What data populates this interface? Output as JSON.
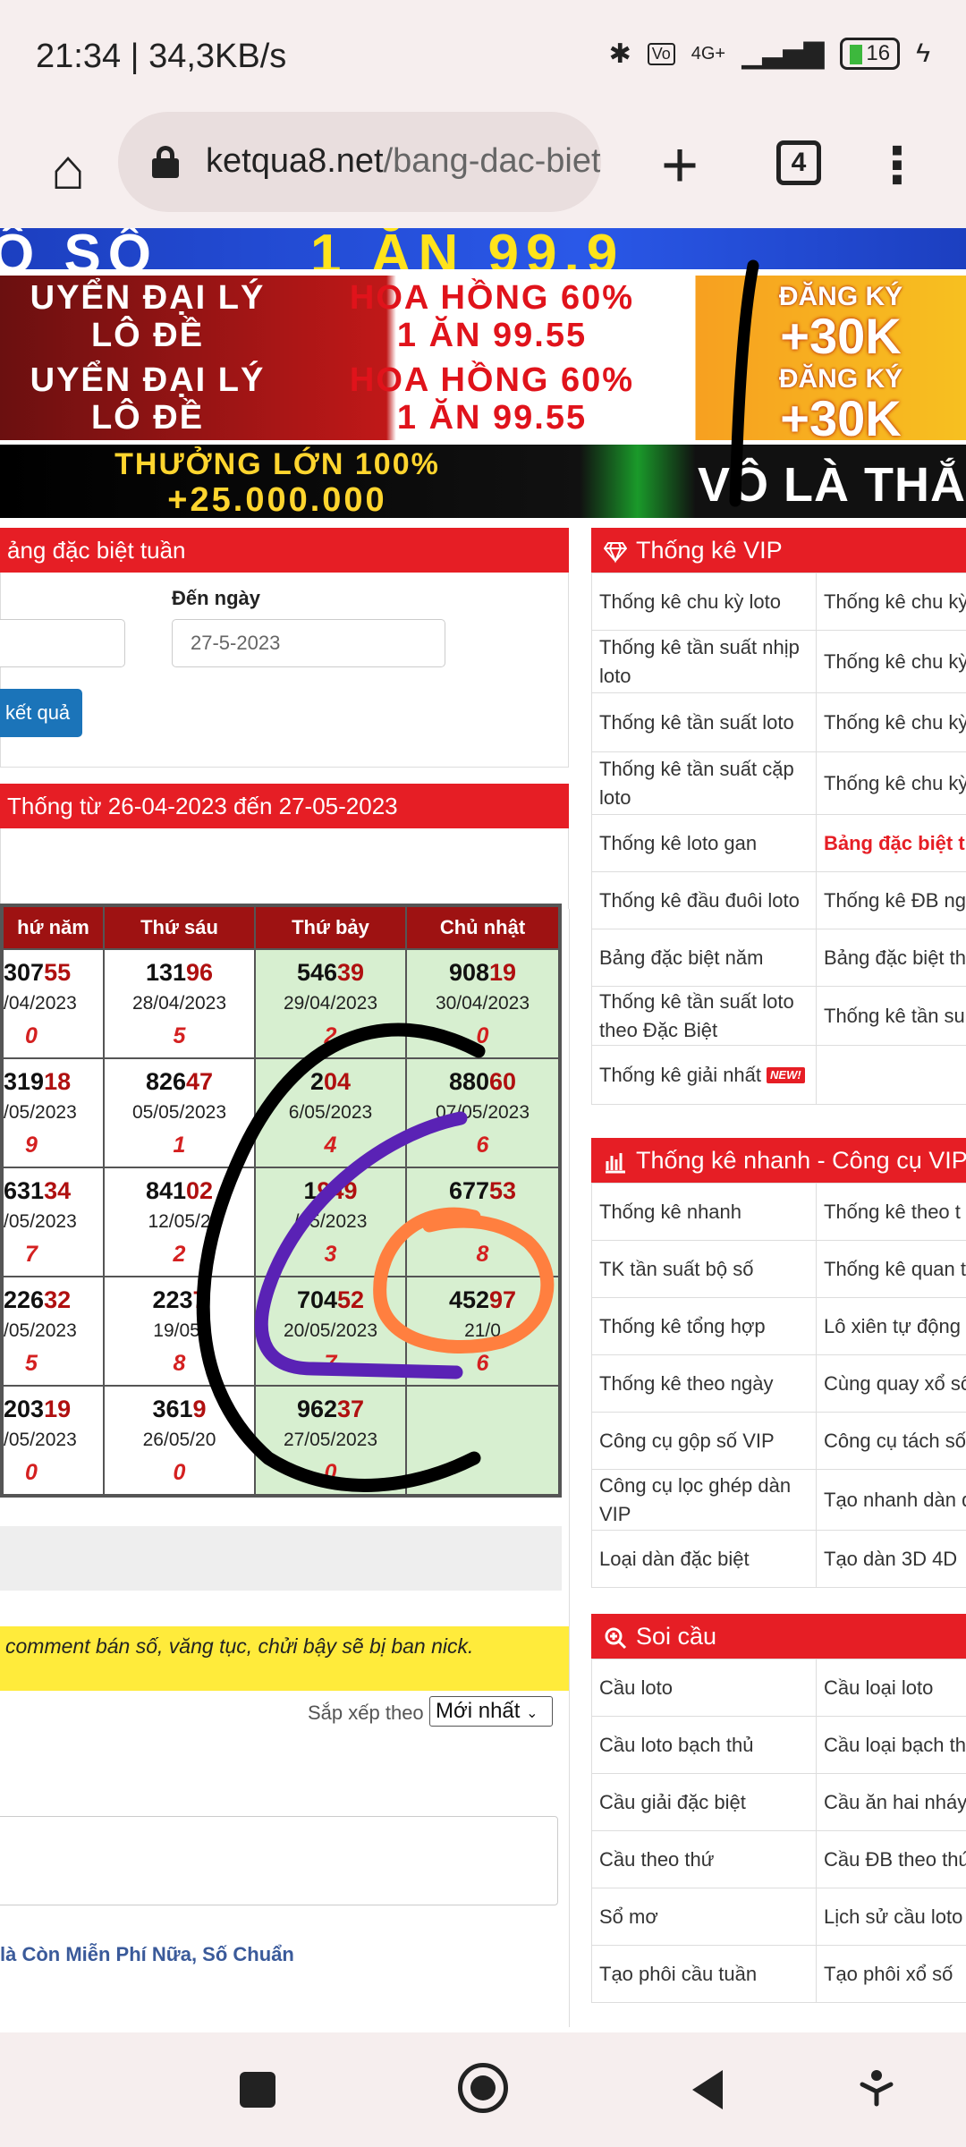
{
  "status": {
    "time": "21:34 | 34,3KB/s",
    "network": "4G+",
    "battery": "16"
  },
  "browser": {
    "url_host": "ketqua8.net",
    "url_path": "/bang-dac-biet",
    "tab_count": "4"
  },
  "banners": {
    "b1_left": "Ô SỐ",
    "b1_right": "1 ĂN 99,9",
    "agent_left": [
      "UYỂN ĐẠI LÝ",
      "LÔ ĐỀ"
    ],
    "agent_mid": [
      "HOA HỒNG 60%",
      "1 ĂN 99.55"
    ],
    "agent_right": [
      "ĐĂNG KÝ",
      "+30K"
    ],
    "b4_left": [
      "THƯỞNG LỚN 100%",
      "+25.000.000"
    ],
    "b4_right": "VÔ LÀ THẮ"
  },
  "main": {
    "header1": "ảng đặc biệt tuần",
    "to_label": "Đến ngày",
    "to_value": "27-5-2023",
    "view_button": "kết quả",
    "header2": "Thống từ 26-04-2023 đến 27-05-2023",
    "table": {
      "headers": [
        "hứ năm",
        "Thứ sáu",
        "Thứ bảy",
        "Chủ nhật"
      ],
      "rows": [
        [
          {
            "head": "307",
            "tail": "55",
            "date": "/04/2023",
            "count": "0"
          },
          {
            "head": "131",
            "tail": "96",
            "date": "28/04/2023",
            "count": "5"
          },
          {
            "head": "546",
            "tail": "39",
            "date": "29/04/2023",
            "count": "2"
          },
          {
            "head": "908",
            "tail": "19",
            "date": "30/04/2023",
            "count": "0"
          }
        ],
        [
          {
            "head": "319",
            "tail": "18",
            "date": "/05/2023",
            "count": "9"
          },
          {
            "head": "826",
            "tail": "47",
            "date": "05/05/2023",
            "count": "1"
          },
          {
            "head": "2",
            "tail": "04",
            "date": "6/05/2023",
            "count": "4"
          },
          {
            "head": "880",
            "tail": "60",
            "date": "07/05/2023",
            "count": "6"
          }
        ],
        [
          {
            "head": "631",
            "tail": "34",
            "date": "/05/2023",
            "count": "7"
          },
          {
            "head": "841",
            "tail": "02",
            "date": "12/05/2",
            "count": "2"
          },
          {
            "head": "1",
            "tail": "949",
            "date": "/05/2023",
            "count": "3"
          },
          {
            "head": "677",
            "tail": "53",
            "date": "",
            "count": "8"
          }
        ],
        [
          {
            "head": "226",
            "tail": "32",
            "date": "/05/2023",
            "count": "5"
          },
          {
            "head": "223",
            "tail": "7",
            "date": "19/05/",
            "count": "8"
          },
          {
            "head": "704",
            "tail": "52",
            "date": "20/05/2023",
            "count": "7"
          },
          {
            "head": "452",
            "tail": "97",
            "date": "21/0",
            "count": "6"
          }
        ],
        [
          {
            "head": "203",
            "tail": "19",
            "date": "/05/2023",
            "count": "0"
          },
          {
            "head": "361",
            "tail": "9",
            "date": "26/05/20",
            "count": "0"
          },
          {
            "head": "962",
            "tail": "37",
            "date": "27/05/2023",
            "count": "0"
          },
          {
            "head": "",
            "tail": "",
            "date": "",
            "count": ""
          }
        ]
      ]
    },
    "notice": "comment bán số, văng tục, chửi bậy sẽ bị ban nick.",
    "sort_label": "Sắp xếp theo",
    "sort_value": "Mới nhất",
    "comment_link": "là Còn Miễn Phí Nữa, Số Chuẩn"
  },
  "sidebar": {
    "vip": {
      "title": "Thống kê VIP",
      "rows": [
        [
          "Thống kê chu kỳ loto",
          "Thống kê chu kỳ"
        ],
        [
          "Thống kê tần suất nhịp loto",
          "Thống kê chu kỳ đặc biệt"
        ],
        [
          "Thống kê tần suất loto",
          "Thống kê chu kỳ loto"
        ],
        [
          "Thống kê tần suất cặp loto",
          "Thống kê chu kỳ dàn cùng về"
        ],
        [
          "Thống kê loto gan",
          "Bảng đặc biệt tu"
        ],
        [
          "Thống kê đầu đuôi loto",
          "Thống kê ĐB ng"
        ],
        [
          "Bảng đặc biệt năm",
          "Bảng đặc biệt th"
        ],
        [
          "Thống kê tần suất loto theo Đặc Biệt",
          "Thống kê tần su theo loto"
        ],
        [
          "Thống kê giải nhất",
          ""
        ]
      ],
      "new_badge": "NEW!"
    },
    "quick": {
      "title": "Thống kê nhanh - Công cụ VIP",
      "rows": [
        [
          "Thống kê nhanh",
          "Thống kê theo t"
        ],
        [
          "TK tần suất bộ số",
          "Thống kê quan t"
        ],
        [
          "Thống kê tổng hợp",
          "Lô xiên tự động"
        ],
        [
          "Thống kê theo ngày",
          "Cùng quay xổ số"
        ],
        [
          "Công cụ gộp số VIP",
          "Công cụ tách số"
        ],
        [
          "Công cụ lọc ghép dàn VIP",
          "Tạo nhanh dàn đặc biệt"
        ],
        [
          "Loại dàn đặc biệt",
          "Tạo dàn 3D 4D"
        ]
      ]
    },
    "soicau": {
      "title": "Soi cầu",
      "rows": [
        [
          "Cầu loto",
          "Cầu loại loto"
        ],
        [
          "Cầu loto bạch thủ",
          "Cầu loại bạch th"
        ],
        [
          "Cầu giải đặc biệt",
          "Cầu ăn hai nháy"
        ],
        [
          "Cầu theo thứ",
          "Cầu ĐB theo thứ"
        ],
        [
          "Sổ mơ",
          "Lịch sử cầu loto"
        ],
        [
          "Tạo phôi cầu tuần",
          "Tạo phôi xổ số"
        ]
      ]
    }
  },
  "colors": {
    "accent_red": "#e61e25",
    "table_header": "#9e1212",
    "weekend_bg": "#d7efd0",
    "notice_bg": "#ffeb3b",
    "button_blue": "#1b74b9"
  }
}
